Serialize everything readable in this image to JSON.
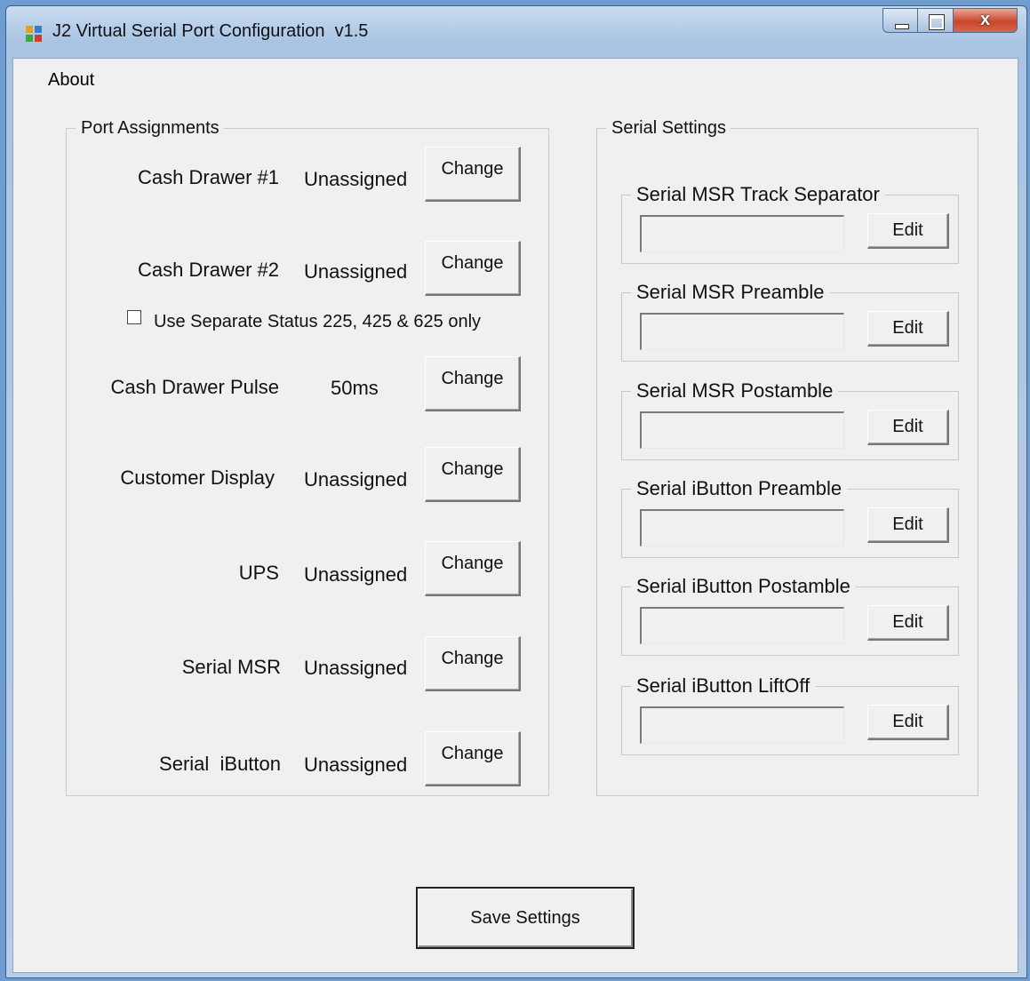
{
  "window": {
    "title": "J2 Virtual Serial Port Configuration  v1.5",
    "close_glyph": "x"
  },
  "menu": {
    "about": "About"
  },
  "port_assignments": {
    "title": "Port Assignments",
    "rows": [
      {
        "label": "Cash Drawer #1",
        "value": "Unassigned",
        "button": "Change"
      },
      {
        "label": "Cash Drawer #2",
        "value": "Unassigned",
        "button": "Change"
      },
      {
        "label": "Cash Drawer Pulse",
        "value": "50ms",
        "button": "Change"
      },
      {
        "label": "Customer Display",
        "value": "Unassigned",
        "button": "Change"
      },
      {
        "label": "UPS",
        "value": "Unassigned",
        "button": "Change"
      },
      {
        "label": "Serial MSR",
        "value": "Unassigned",
        "button": "Change"
      },
      {
        "label": "Serial  iButton",
        "value": "Unassigned",
        "button": "Change"
      }
    ],
    "separate_status": {
      "label": "Use Separate Status 225, 425 & 625 only",
      "checked": false
    }
  },
  "serial_settings": {
    "title": "Serial Settings",
    "groups": [
      {
        "title": "Serial MSR Track Separator",
        "value": "",
        "button": "Edit"
      },
      {
        "title": "Serial MSR Preamble",
        "value": "",
        "button": "Edit"
      },
      {
        "title": "Serial MSR Postamble",
        "value": "",
        "button": "Edit"
      },
      {
        "title": "Serial iButton Preamble",
        "value": "",
        "button": "Edit"
      },
      {
        "title": "Serial iButton Postamble",
        "value": "",
        "button": "Edit"
      },
      {
        "title": "Serial iButton LiftOff",
        "value": "",
        "button": "Edit"
      }
    ]
  },
  "save_button": "Save Settings",
  "colors": {
    "client_bg": "#f0f0f0",
    "title_bar": "#b8cde8",
    "close_button": "#c7462b"
  },
  "icons": [
    "app-icon",
    "minimize-icon",
    "maximize-icon",
    "close-icon",
    "checkbox-icon"
  ]
}
